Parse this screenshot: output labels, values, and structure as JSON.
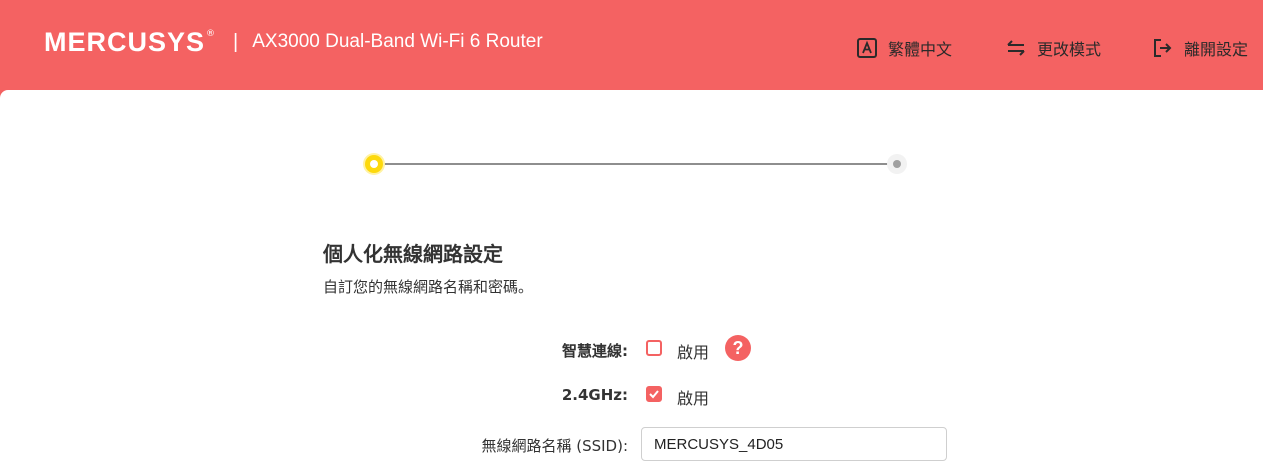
{
  "header": {
    "logo": "MERCUSYS",
    "logo_mark": "®",
    "separator": "|",
    "product_name": "AX3000 Dual-Band Wi-Fi 6 Router",
    "nav": [
      {
        "label": "繁體中文",
        "icon": "language-icon"
      },
      {
        "label": "更改模式",
        "icon": "switch-mode-icon"
      },
      {
        "label": "離開設定",
        "icon": "exit-icon"
      }
    ]
  },
  "stepper": {
    "current_step": 1,
    "total_steps": 2
  },
  "main": {
    "title": "個人化無線網路設定",
    "description": "自訂您的無線網路名稱和密碼。",
    "smart_connect": {
      "label": "智慧連線:",
      "checkbox_label": "啟用",
      "checked": false,
      "help_icon": "?"
    },
    "band_24": {
      "label": "2.4GHz:",
      "checkbox_label": "啟用",
      "checked": true
    },
    "ssid": {
      "label": "無線網路名稱 (SSID):",
      "value": "MERCUSYS_4D05"
    }
  },
  "colors": {
    "brand": "#f46262",
    "step_active": "#fdd90d",
    "text": "#333333"
  }
}
